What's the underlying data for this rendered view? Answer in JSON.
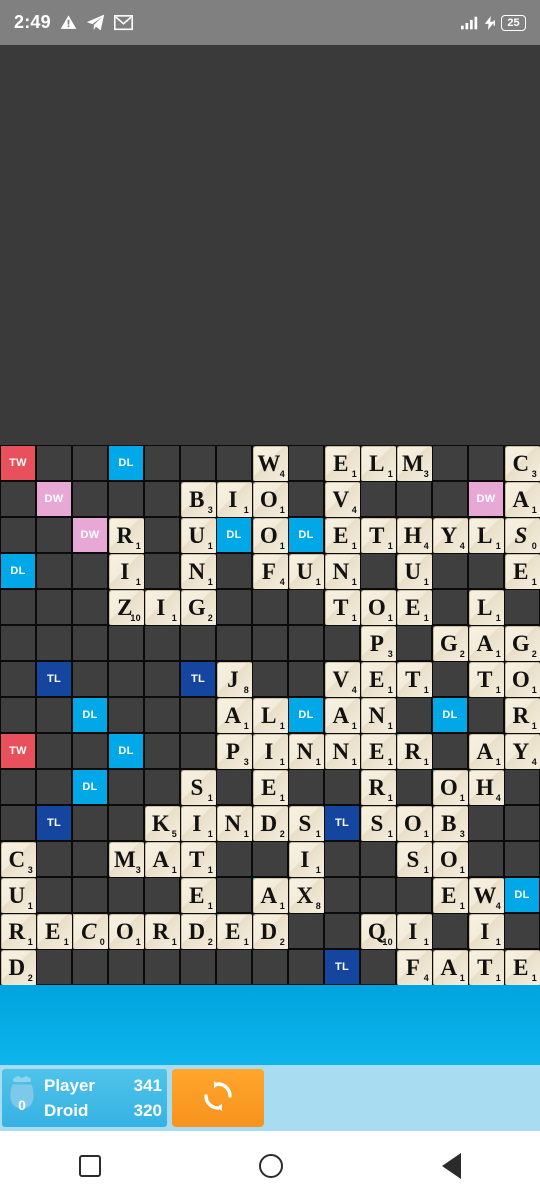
{
  "status_bar": {
    "clock": "2:49",
    "icons": [
      "warning-icon",
      "telegram-icon",
      "gmail-icon"
    ],
    "signal_icon": "signal-bars-icon",
    "charging_icon": "charging-bolt-icon",
    "battery_level": "25"
  },
  "game": {
    "board_size": 15,
    "premium_legend": {
      "TW": "TW",
      "DW": "DW",
      "TL": "TL",
      "DL": "DL"
    },
    "colors": {
      "triple_word": "#e8505b",
      "double_word": "#e7a8d6",
      "triple_letter": "#1446a0",
      "double_letter": "#00a8e8",
      "empty_cell": "#3f3f3f",
      "tile_face": "#f5efe0",
      "panel_blue": "#36b2e3",
      "swap_orange": "#f7931e"
    },
    "premium_squares": [
      {
        "r": 0,
        "c": 0,
        "type": "TW"
      },
      {
        "r": 0,
        "c": 3,
        "type": "DL"
      },
      {
        "r": 1,
        "c": 1,
        "type": "DW"
      },
      {
        "r": 1,
        "c": 13,
        "type": "DW"
      },
      {
        "r": 2,
        "c": 2,
        "type": "DW"
      },
      {
        "r": 2,
        "c": 6,
        "type": "DL"
      },
      {
        "r": 2,
        "c": 8,
        "type": "DL"
      },
      {
        "r": 3,
        "c": 0,
        "type": "DL"
      },
      {
        "r": 6,
        "c": 1,
        "type": "TL"
      },
      {
        "r": 6,
        "c": 5,
        "type": "TL"
      },
      {
        "r": 6,
        "c": 9,
        "type": "TL"
      },
      {
        "r": 7,
        "c": 2,
        "type": "DL"
      },
      {
        "r": 7,
        "c": 8,
        "type": "DL"
      },
      {
        "r": 7,
        "c": 12,
        "type": "DL"
      },
      {
        "r": 8,
        "c": 0,
        "type": "TW"
      },
      {
        "r": 8,
        "c": 3,
        "type": "DL"
      },
      {
        "r": 8,
        "c": 11,
        "type": "DL"
      },
      {
        "r": 9,
        "c": 2,
        "type": "DL"
      },
      {
        "r": 9,
        "c": 12,
        "type": "DL"
      },
      {
        "r": 10,
        "c": 1,
        "type": "TL"
      },
      {
        "r": 10,
        "c": 9,
        "type": "TL"
      },
      {
        "r": 12,
        "c": 7,
        "type": "DL"
      },
      {
        "r": 12,
        "c": 14,
        "type": "DL"
      },
      {
        "r": 13,
        "c": 2,
        "type": "DW"
      },
      {
        "r": 13,
        "c": 6,
        "type": "DL"
      },
      {
        "r": 14,
        "c": 9,
        "type": "TL"
      },
      {
        "r": 15,
        "c": 3,
        "type": "DL"
      },
      {
        "r": 15,
        "c": 7,
        "type": "TW"
      }
    ],
    "tiles": [
      {
        "r": 0,
        "c": 7,
        "letter": "W",
        "value": "4"
      },
      {
        "r": 0,
        "c": 9,
        "letter": "E",
        "value": "1"
      },
      {
        "r": 0,
        "c": 10,
        "letter": "L",
        "value": "1"
      },
      {
        "r": 0,
        "c": 11,
        "letter": "M",
        "value": "3"
      },
      {
        "r": 0,
        "c": 14,
        "letter": "C",
        "value": "3"
      },
      {
        "r": 1,
        "c": 5,
        "letter": "B",
        "value": "3"
      },
      {
        "r": 1,
        "c": 6,
        "letter": "I",
        "value": "1"
      },
      {
        "r": 1,
        "c": 7,
        "letter": "O",
        "value": "1"
      },
      {
        "r": 1,
        "c": 9,
        "letter": "V",
        "value": "4"
      },
      {
        "r": 1,
        "c": 14,
        "letter": "A",
        "value": "1"
      },
      {
        "r": 2,
        "c": 3,
        "letter": "R",
        "value": "1"
      },
      {
        "r": 2,
        "c": 5,
        "letter": "U",
        "value": "1"
      },
      {
        "r": 2,
        "c": 7,
        "letter": "O",
        "value": "1"
      },
      {
        "r": 2,
        "c": 9,
        "letter": "E",
        "value": "1"
      },
      {
        "r": 2,
        "c": 10,
        "letter": "T",
        "value": "1"
      },
      {
        "r": 2,
        "c": 11,
        "letter": "H",
        "value": "4"
      },
      {
        "r": 2,
        "c": 12,
        "letter": "Y",
        "value": "4"
      },
      {
        "r": 2,
        "c": 13,
        "letter": "L",
        "value": "1"
      },
      {
        "r": 2,
        "c": 14,
        "letter": "S",
        "value": "0",
        "blank": true
      },
      {
        "r": 3,
        "c": 3,
        "letter": "I",
        "value": "1"
      },
      {
        "r": 3,
        "c": 5,
        "letter": "N",
        "value": "1"
      },
      {
        "r": 3,
        "c": 7,
        "letter": "F",
        "value": "4"
      },
      {
        "r": 3,
        "c": 8,
        "letter": "U",
        "value": "1"
      },
      {
        "r": 3,
        "c": 9,
        "letter": "N",
        "value": "1"
      },
      {
        "r": 3,
        "c": 11,
        "letter": "U",
        "value": "1"
      },
      {
        "r": 3,
        "c": 14,
        "letter": "E",
        "value": "1"
      },
      {
        "r": 4,
        "c": 3,
        "letter": "Z",
        "value": "10"
      },
      {
        "r": 4,
        "c": 4,
        "letter": "I",
        "value": "1"
      },
      {
        "r": 4,
        "c": 5,
        "letter": "G",
        "value": "2"
      },
      {
        "r": 4,
        "c": 9,
        "letter": "T",
        "value": "1"
      },
      {
        "r": 4,
        "c": 10,
        "letter": "O",
        "value": "1"
      },
      {
        "r": 4,
        "c": 11,
        "letter": "E",
        "value": "1"
      },
      {
        "r": 4,
        "c": 13,
        "letter": "L",
        "value": "1"
      },
      {
        "r": 5,
        "c": 10,
        "letter": "P",
        "value": "3"
      },
      {
        "r": 5,
        "c": 12,
        "letter": "G",
        "value": "2"
      },
      {
        "r": 5,
        "c": 13,
        "letter": "A",
        "value": "1"
      },
      {
        "r": 5,
        "c": 14,
        "letter": "G",
        "value": "2"
      },
      {
        "r": 6,
        "c": 6,
        "letter": "J",
        "value": "8"
      },
      {
        "r": 6,
        "c": 9,
        "letter": "V",
        "value": "4"
      },
      {
        "r": 6,
        "c": 10,
        "letter": "E",
        "value": "1"
      },
      {
        "r": 6,
        "c": 11,
        "letter": "T",
        "value": "1"
      },
      {
        "r": 6,
        "c": 13,
        "letter": "T",
        "value": "1"
      },
      {
        "r": 6,
        "c": 14,
        "letter": "O",
        "value": "1"
      },
      {
        "r": 7,
        "c": 6,
        "letter": "A",
        "value": "1"
      },
      {
        "r": 7,
        "c": 7,
        "letter": "L",
        "value": "1"
      },
      {
        "r": 7,
        "c": 9,
        "letter": "A",
        "value": "1"
      },
      {
        "r": 7,
        "c": 10,
        "letter": "N",
        "value": "1"
      },
      {
        "r": 7,
        "c": 14,
        "letter": "R",
        "value": "1"
      },
      {
        "r": 8,
        "c": 6,
        "letter": "P",
        "value": "3"
      },
      {
        "r": 8,
        "c": 7,
        "letter": "I",
        "value": "1"
      },
      {
        "r": 8,
        "c": 8,
        "letter": "N",
        "value": "1"
      },
      {
        "r": 8,
        "c": 9,
        "letter": "N",
        "value": "1"
      },
      {
        "r": 8,
        "c": 10,
        "letter": "E",
        "value": "1"
      },
      {
        "r": 8,
        "c": 11,
        "letter": "R",
        "value": "1"
      },
      {
        "r": 8,
        "c": 13,
        "letter": "A",
        "value": "1"
      },
      {
        "r": 8,
        "c": 14,
        "letter": "Y",
        "value": "4"
      },
      {
        "r": 9,
        "c": 5,
        "letter": "S",
        "value": "1"
      },
      {
        "r": 9,
        "c": 7,
        "letter": "E",
        "value": "1"
      },
      {
        "r": 9,
        "c": 10,
        "letter": "R",
        "value": "1"
      },
      {
        "r": 9,
        "c": 12,
        "letter": "O",
        "value": "1"
      },
      {
        "r": 9,
        "c": 13,
        "letter": "H",
        "value": "4"
      },
      {
        "r": 10,
        "c": 4,
        "letter": "K",
        "value": "5"
      },
      {
        "r": 10,
        "c": 5,
        "letter": "I",
        "value": "1"
      },
      {
        "r": 10,
        "c": 6,
        "letter": "N",
        "value": "1"
      },
      {
        "r": 10,
        "c": 7,
        "letter": "D",
        "value": "2"
      },
      {
        "r": 10,
        "c": 8,
        "letter": "S",
        "value": "1"
      },
      {
        "r": 10,
        "c": 10,
        "letter": "S",
        "value": "1"
      },
      {
        "r": 10,
        "c": 11,
        "letter": "O",
        "value": "1"
      },
      {
        "r": 10,
        "c": 12,
        "letter": "B",
        "value": "3"
      },
      {
        "r": 11,
        "c": 0,
        "letter": "C",
        "value": "3"
      },
      {
        "r": 11,
        "c": 3,
        "letter": "M",
        "value": "3"
      },
      {
        "r": 11,
        "c": 4,
        "letter": "A",
        "value": "1"
      },
      {
        "r": 11,
        "c": 5,
        "letter": "T",
        "value": "1"
      },
      {
        "r": 11,
        "c": 8,
        "letter": "I",
        "value": "1"
      },
      {
        "r": 11,
        "c": 11,
        "letter": "S",
        "value": "1"
      },
      {
        "r": 11,
        "c": 12,
        "letter": "O",
        "value": "1"
      },
      {
        "r": 12,
        "c": 0,
        "letter": "U",
        "value": "1"
      },
      {
        "r": 12,
        "c": 5,
        "letter": "E",
        "value": "1"
      },
      {
        "r": 12,
        "c": 7,
        "letter": "A",
        "value": "1"
      },
      {
        "r": 12,
        "c": 8,
        "letter": "X",
        "value": "8"
      },
      {
        "r": 12,
        "c": 12,
        "letter": "E",
        "value": "1"
      },
      {
        "r": 12,
        "c": 13,
        "letter": "W",
        "value": "4"
      },
      {
        "r": 13,
        "c": 0,
        "letter": "R",
        "value": "1"
      },
      {
        "r": 13,
        "c": 1,
        "letter": "E",
        "value": "1"
      },
      {
        "r": 13,
        "c": 2,
        "letter": "C",
        "value": "0",
        "blank": true
      },
      {
        "r": 13,
        "c": 3,
        "letter": "O",
        "value": "1"
      },
      {
        "r": 13,
        "c": 4,
        "letter": "R",
        "value": "1"
      },
      {
        "r": 13,
        "c": 5,
        "letter": "D",
        "value": "2"
      },
      {
        "r": 13,
        "c": 6,
        "letter": "E",
        "value": "1"
      },
      {
        "r": 13,
        "c": 7,
        "letter": "D",
        "value": "2"
      },
      {
        "r": 13,
        "c": 10,
        "letter": "Q",
        "value": "10"
      },
      {
        "r": 13,
        "c": 11,
        "letter": "I",
        "value": "1"
      },
      {
        "r": 13,
        "c": 13,
        "letter": "I",
        "value": "1"
      },
      {
        "r": 14,
        "c": 0,
        "letter": "D",
        "value": "2"
      },
      {
        "r": 14,
        "c": 11,
        "letter": "F",
        "value": "4"
      },
      {
        "r": 14,
        "c": 12,
        "letter": "A",
        "value": "1"
      },
      {
        "r": 14,
        "c": 13,
        "letter": "T",
        "value": "1"
      },
      {
        "r": 14,
        "c": 14,
        "letter": "E",
        "value": "1"
      }
    ]
  },
  "scoreboard": {
    "bag_icon": "tile-bag-icon",
    "bag_count": "0",
    "player_name": "Player",
    "player_score": "341",
    "opponent_name": "Droid",
    "opponent_score": "320"
  },
  "swap_button": {
    "icon": "shuffle-refresh-icon",
    "label": ""
  },
  "navigation_bar": {
    "recents": "recents-square-icon",
    "home": "home-circle-icon",
    "back": "back-triangle-icon"
  }
}
